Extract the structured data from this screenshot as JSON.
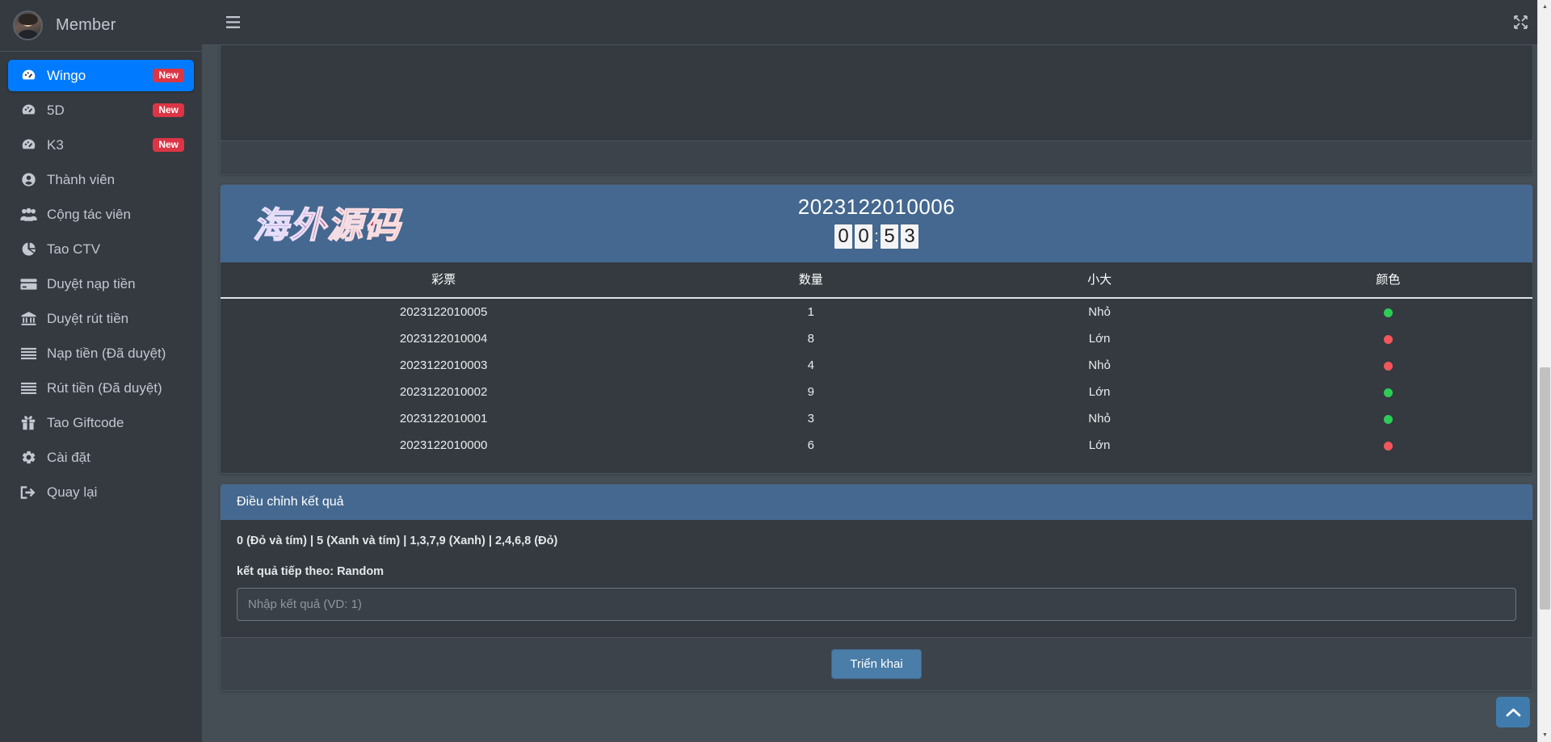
{
  "sidebar": {
    "brand_name": "Member",
    "avatar_icon": "user-avatar",
    "items": [
      {
        "label": "Wingo",
        "icon": "dashboard-icon",
        "badge": "New",
        "active": true
      },
      {
        "label": "5D",
        "icon": "dashboard-icon",
        "badge": "New",
        "active": false
      },
      {
        "label": "K3",
        "icon": "dashboard-icon",
        "badge": "New",
        "active": false
      },
      {
        "label": "Thành viên",
        "icon": "user-circle-icon",
        "badge": "",
        "active": false
      },
      {
        "label": "Cộng tác viên",
        "icon": "users-icon",
        "badge": "",
        "active": false
      },
      {
        "label": "Tao CTV",
        "icon": "pie-chart-icon",
        "badge": "",
        "active": false
      },
      {
        "label": "Duyệt nạp tiền",
        "icon": "credit-card-icon",
        "badge": "",
        "active": false
      },
      {
        "label": "Duyệt rút tiền",
        "icon": "bank-icon",
        "badge": "",
        "active": false
      },
      {
        "label": "Nạp tiền (Đã duyệt)",
        "icon": "list-icon",
        "badge": "",
        "active": false
      },
      {
        "label": "Rút tiền (Đã duyệt)",
        "icon": "list-icon",
        "badge": "",
        "active": false
      },
      {
        "label": "Tao Giftcode",
        "icon": "gift-icon",
        "badge": "",
        "active": false
      },
      {
        "label": "Cài đặt",
        "icon": "gear-icon",
        "badge": "",
        "active": false
      },
      {
        "label": "Quay lại",
        "icon": "sign-out-icon",
        "badge": "",
        "active": false
      }
    ]
  },
  "topbar": {
    "menu_icon": "hamburger-icon",
    "fullscreen_icon": "expand-arrows-icon"
  },
  "lottery": {
    "logo_text": "海外源码",
    "period_number": "2023122010006",
    "countdown": {
      "d1": "0",
      "d2": "0",
      "colon": ":",
      "d3": "5",
      "d4": "3"
    },
    "columns": [
      "彩票",
      "数量",
      "小大",
      "颜色"
    ],
    "rows": [
      {
        "ticket": "2023122010005",
        "qty": "1",
        "qty_color": "green",
        "size": "Nhỏ",
        "dot": "green"
      },
      {
        "ticket": "2023122010004",
        "qty": "8",
        "qty_color": "red",
        "size": "Lớn",
        "dot": "red"
      },
      {
        "ticket": "2023122010003",
        "qty": "4",
        "qty_color": "red",
        "size": "Nhỏ",
        "dot": "red"
      },
      {
        "ticket": "2023122010002",
        "qty": "9",
        "qty_color": "green",
        "size": "Lớn",
        "dot": "green"
      },
      {
        "ticket": "2023122010001",
        "qty": "3",
        "qty_color": "green",
        "size": "Nhỏ",
        "dot": "green"
      },
      {
        "ticket": "2023122010000",
        "qty": "6",
        "qty_color": "red",
        "size": "Lớn",
        "dot": "red"
      }
    ]
  },
  "adjust": {
    "title": "Điều chỉnh kết quả",
    "rule_text": "0 (Đỏ và tím) | 5 (Xanh và tím) | 1,3,7,9 (Xanh) | 2,4,6,8 (Đỏ)",
    "next_result_text": "kết quả tiếp theo: Random",
    "input_placeholder": "Nhập kết quả (VD: 1)",
    "input_value": "",
    "deploy_button": "Triển khai"
  },
  "back_to_top": {
    "icon": "chevron-up-icon"
  },
  "colors": {
    "accent_blue": "#007bff",
    "panel_header_blue": "#44688f",
    "badge_red": "#dc3545",
    "sidebar_bg": "#343a40",
    "content_bg": "#454d55",
    "card_bg": "#343a40",
    "green": "#28a745",
    "red": "#ec5e63"
  }
}
